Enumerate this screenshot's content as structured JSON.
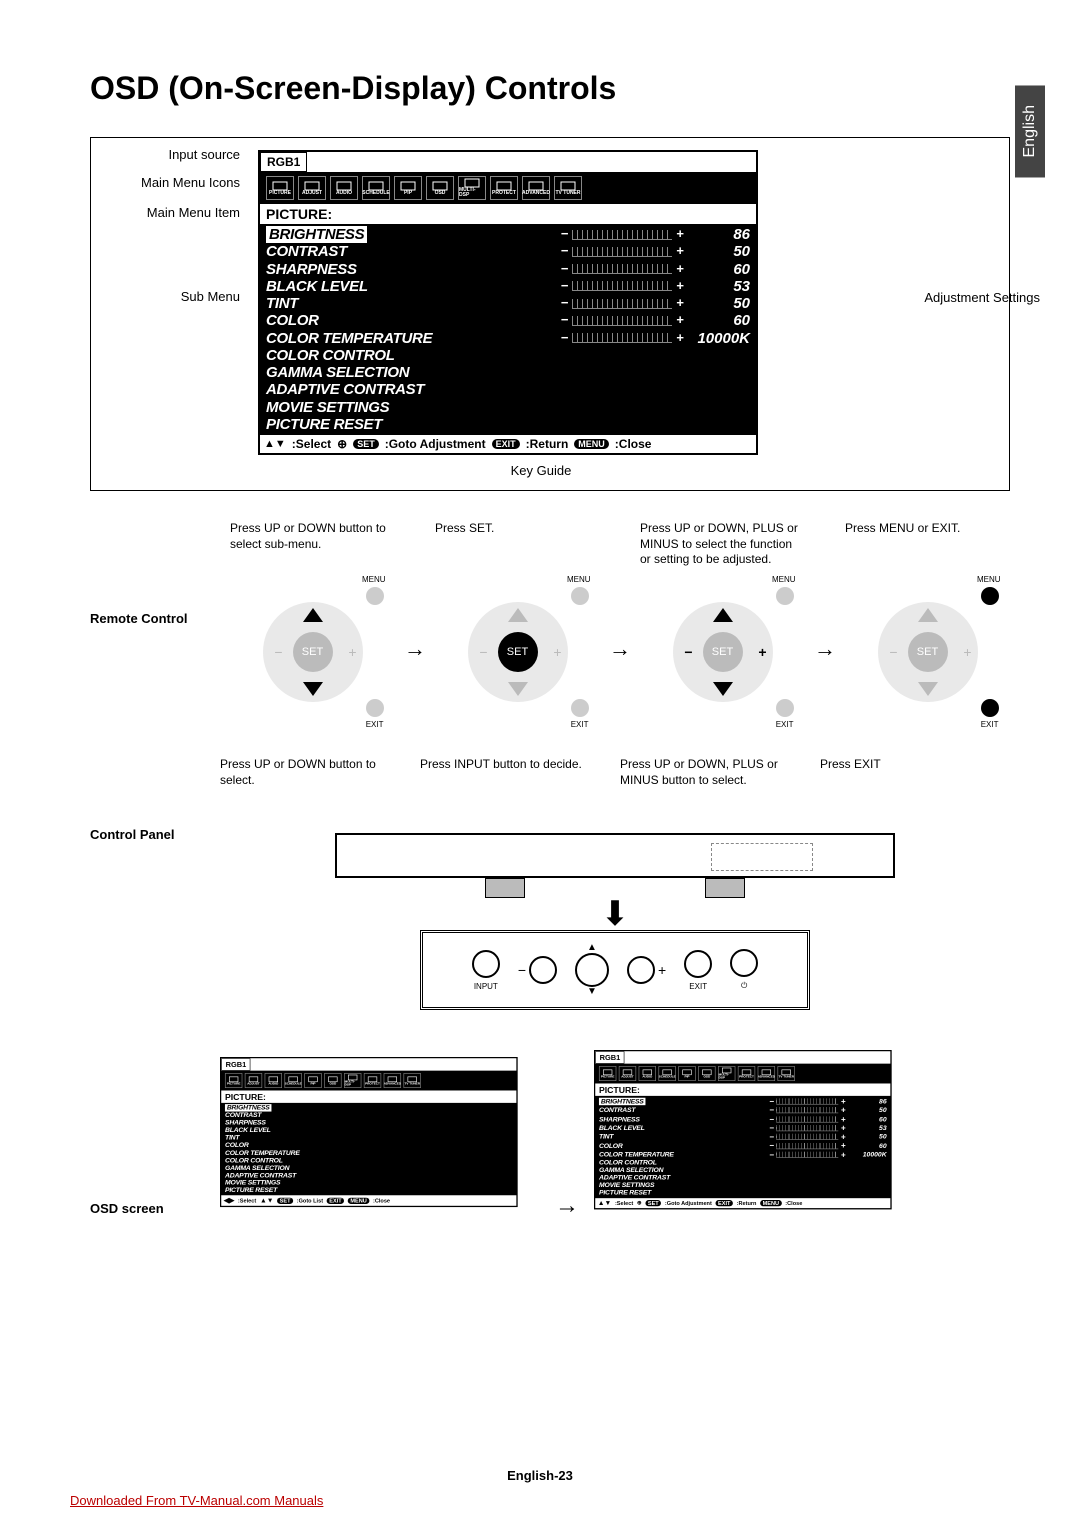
{
  "page": {
    "title": "OSD (On-Screen-Display) Controls",
    "language_tab": "English",
    "footer": "English-23",
    "download_note": "Downloaded From TV-Manual.com Manuals"
  },
  "figure_labels": {
    "input_source": "Input source",
    "main_menu_icons": "Main Menu Icons",
    "main_menu_item": "Main Menu Item",
    "sub_menu": "Sub Menu",
    "adjustment_settings": "Adjustment Settings",
    "key_guide": "Key Guide"
  },
  "osd": {
    "source": "RGB1",
    "menu_icons": [
      "PICTURE",
      "ADJUST",
      "AUDIO",
      "SCHEDULE",
      "PIP",
      "OSD",
      "MULTI-DSP",
      "PROTECT",
      "ADVANCED",
      "TV TUNER"
    ],
    "heading": "PICTURE:",
    "items": [
      {
        "name": "BRIGHTNESS",
        "value": "86",
        "bar": true,
        "selected": true
      },
      {
        "name": "CONTRAST",
        "value": "50",
        "bar": true
      },
      {
        "name": "SHARPNESS",
        "value": "60",
        "bar": true
      },
      {
        "name": "BLACK LEVEL",
        "value": "53",
        "bar": true
      },
      {
        "name": "TINT",
        "value": "50",
        "bar": true
      },
      {
        "name": "COLOR",
        "value": "60",
        "bar": true
      },
      {
        "name": "COLOR TEMPERATURE",
        "value": "10000K",
        "bar": true
      },
      {
        "name": "COLOR CONTROL",
        "value": "",
        "bar": false
      },
      {
        "name": "GAMMA SELECTION",
        "value": "",
        "bar": false
      },
      {
        "name": "ADAPTIVE CONTRAST",
        "value": "",
        "bar": false
      },
      {
        "name": "MOVIE SETTINGS",
        "value": "",
        "bar": false
      },
      {
        "name": "PICTURE RESET",
        "value": "",
        "bar": false
      }
    ],
    "guide_main": {
      "select": ":Select",
      "goto": ":Goto Adjustment",
      "ret": ":Return",
      "close": ":Close",
      "set": "SET",
      "exit": "EXIT",
      "menu": "MENU"
    },
    "guide_list": {
      "select": ":Select",
      "goto": ":Goto List",
      "close": ":Close",
      "set": "SET",
      "exit": "EXIT",
      "menu": "MENU"
    }
  },
  "remote_section": {
    "label": "Remote Control",
    "steps": [
      "Press UP or DOWN button to select sub-menu.",
      "Press SET.",
      "Press UP or DOWN, PLUS or MINUS to select the function or setting to be adjusted.",
      "Press MENU or EXIT."
    ],
    "btn_labels": {
      "set": "SET",
      "menu": "MENU",
      "exit": "EXIT",
      "minus": "−",
      "plus": "+"
    }
  },
  "control_panel_section": {
    "label": "Control Panel",
    "steps": [
      "Press UP or DOWN button to select.",
      "Press INPUT button to decide.",
      "Press UP or DOWN, PLUS or MINUS button to select.",
      "Press EXIT"
    ],
    "panel_labels": {
      "input": "INPUT",
      "exit": "EXIT",
      "minus": "−",
      "plus": "+",
      "up": "▲",
      "down": "▼"
    }
  },
  "osd_screen_section": {
    "label": "OSD screen"
  }
}
